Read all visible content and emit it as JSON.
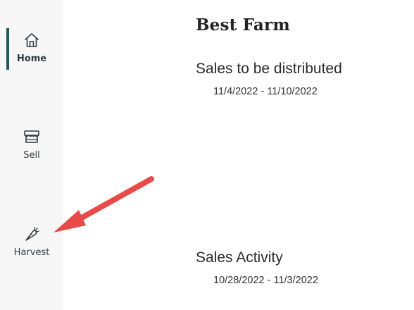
{
  "sidebar": {
    "items": [
      {
        "label": "Home",
        "icon": "home-icon",
        "active": true
      },
      {
        "label": "Sell",
        "icon": "storefront-icon",
        "active": false
      },
      {
        "label": "Harvest",
        "icon": "carrot-icon",
        "active": false
      }
    ]
  },
  "main": {
    "farm_name": "Best Farm",
    "sales_distributed": {
      "title": "Sales to be distributed",
      "date_range": "11/4/2022 - 11/10/2022"
    },
    "sales_activity": {
      "title": "Sales Activity",
      "date_range": "10/28/2022 - 11/3/2022"
    }
  },
  "annotation": {
    "arrow_color": "#e84a4a",
    "points_to": "Harvest"
  },
  "colors": {
    "sidebar_bg": "#f7f7f7",
    "active_indicator": "#1f5a5a"
  }
}
